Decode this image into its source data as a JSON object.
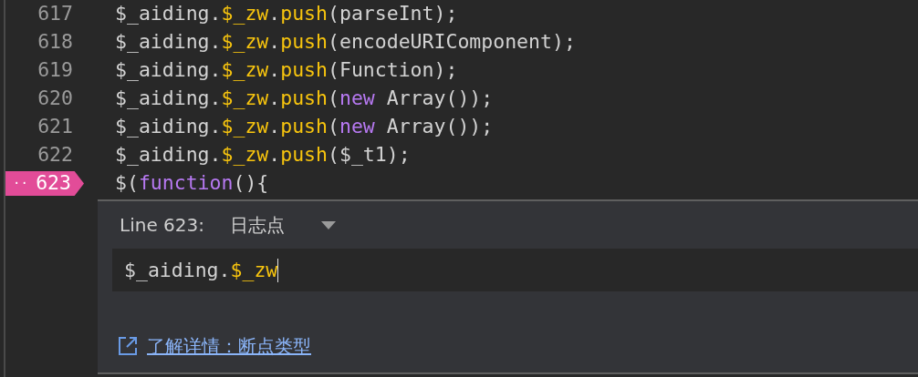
{
  "lines": [
    {
      "number": "617",
      "logpoint": false,
      "tokens": [
        {
          "kind": "plain",
          "text": "$_aiding."
        },
        {
          "kind": "property",
          "text": "$_zw"
        },
        {
          "kind": "plain",
          "text": "."
        },
        {
          "kind": "property",
          "text": "push"
        },
        {
          "kind": "plain",
          "text": "(parseInt);"
        }
      ]
    },
    {
      "number": "618",
      "logpoint": false,
      "tokens": [
        {
          "kind": "plain",
          "text": "$_aiding."
        },
        {
          "kind": "property",
          "text": "$_zw"
        },
        {
          "kind": "plain",
          "text": "."
        },
        {
          "kind": "property",
          "text": "push"
        },
        {
          "kind": "plain",
          "text": "(encodeURIComponent);"
        }
      ]
    },
    {
      "number": "619",
      "logpoint": false,
      "tokens": [
        {
          "kind": "plain",
          "text": "$_aiding."
        },
        {
          "kind": "property",
          "text": "$_zw"
        },
        {
          "kind": "plain",
          "text": "."
        },
        {
          "kind": "property",
          "text": "push"
        },
        {
          "kind": "plain",
          "text": "(Function);"
        }
      ]
    },
    {
      "number": "620",
      "logpoint": false,
      "tokens": [
        {
          "kind": "plain",
          "text": "$_aiding."
        },
        {
          "kind": "property",
          "text": "$_zw"
        },
        {
          "kind": "plain",
          "text": "."
        },
        {
          "kind": "property",
          "text": "push"
        },
        {
          "kind": "plain",
          "text": "("
        },
        {
          "kind": "keyword",
          "text": "new"
        },
        {
          "kind": "plain",
          "text": " Array());"
        }
      ]
    },
    {
      "number": "621",
      "logpoint": false,
      "tokens": [
        {
          "kind": "plain",
          "text": "$_aiding."
        },
        {
          "kind": "property",
          "text": "$_zw"
        },
        {
          "kind": "plain",
          "text": "."
        },
        {
          "kind": "property",
          "text": "push"
        },
        {
          "kind": "plain",
          "text": "("
        },
        {
          "kind": "keyword",
          "text": "new"
        },
        {
          "kind": "plain",
          "text": " Array());"
        }
      ]
    },
    {
      "number": "622",
      "logpoint": false,
      "tokens": [
        {
          "kind": "plain",
          "text": "$_aiding."
        },
        {
          "kind": "property",
          "text": "$_zw"
        },
        {
          "kind": "plain",
          "text": "."
        },
        {
          "kind": "property",
          "text": "push"
        },
        {
          "kind": "plain",
          "text": "($_t1);"
        }
      ]
    },
    {
      "number": "623",
      "logpoint": true,
      "marker_dots": "··",
      "tokens": [
        {
          "kind": "plain",
          "text": "$("
        },
        {
          "kind": "keyword",
          "text": "function"
        },
        {
          "kind": "plain",
          "text": "(){"
        }
      ]
    }
  ],
  "editor": {
    "line_label": "Line 623:",
    "type_select": "日志点",
    "expression": [
      {
        "kind": "plain",
        "text": "$_aiding."
      },
      {
        "kind": "property",
        "text": "$_zw"
      }
    ],
    "learn_more_link": "了解详情：断点类型"
  }
}
